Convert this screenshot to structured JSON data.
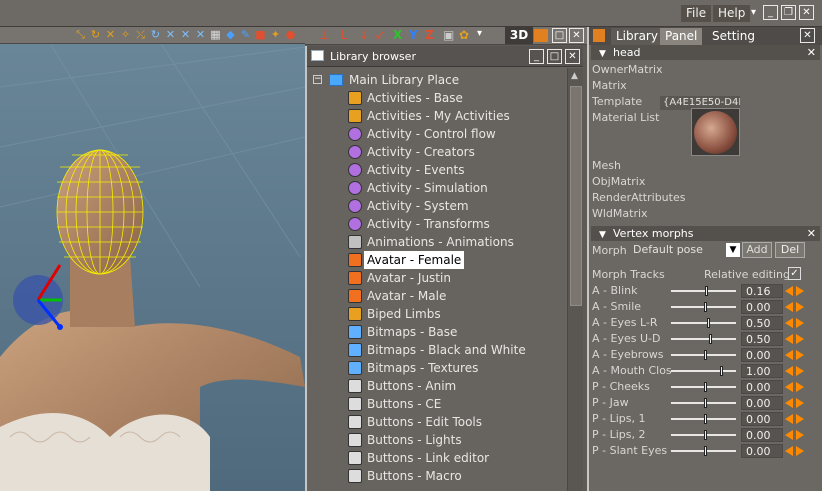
{
  "menubar": {
    "file": "File",
    "help": "Help"
  },
  "viewport": {
    "mode_label": "3D"
  },
  "library": {
    "title": "Library browser",
    "root": "Main Library Place",
    "items": [
      {
        "label": "Activities - Base",
        "icon": "activity-box-icon"
      },
      {
        "label": "Activities - My Activities",
        "icon": "activity-box-icon"
      },
      {
        "label": "Activity - Control flow",
        "icon": "activity-icon"
      },
      {
        "label": "Activity - Creators",
        "icon": "activity-icon"
      },
      {
        "label": "Activity - Events",
        "icon": "activity-icon"
      },
      {
        "label": "Activity - Simulation",
        "icon": "activity-icon"
      },
      {
        "label": "Activity - System",
        "icon": "activity-icon"
      },
      {
        "label": "Activity - Transforms",
        "icon": "activity-icon"
      },
      {
        "label": "Animations - Animations",
        "icon": "animation-icon"
      },
      {
        "label": "Avatar - Female",
        "icon": "avatar-icon",
        "selected": true
      },
      {
        "label": "Avatar - Justin",
        "icon": "avatar-icon"
      },
      {
        "label": "Avatar - Male",
        "icon": "avatar-icon"
      },
      {
        "label": "Biped Limbs",
        "icon": "biped-icon"
      },
      {
        "label": "Bitmaps - Base",
        "icon": "bitmap-icon"
      },
      {
        "label": "Bitmaps - Black and White",
        "icon": "bitmap-icon"
      },
      {
        "label": "Bitmaps - Textures",
        "icon": "bitmap-icon"
      },
      {
        "label": "Buttons - Anim",
        "icon": "button-icon"
      },
      {
        "label": "Buttons - CE",
        "icon": "button-icon"
      },
      {
        "label": "Buttons - Edit Tools",
        "icon": "button-icon"
      },
      {
        "label": "Buttons - Lights",
        "icon": "button-icon"
      },
      {
        "label": "Buttons - Link editor",
        "icon": "button-icon"
      },
      {
        "label": "Buttons - Macro",
        "icon": "button-icon"
      }
    ]
  },
  "panel": {
    "tabs": [
      "Library",
      "Panel",
      "Setting"
    ],
    "head_section": "head",
    "properties": [
      "OwnerMatrix",
      "Matrix",
      "Template",
      "Material List",
      "Mesh",
      "ObjMatrix",
      "RenderAttributes",
      "WldMatrix"
    ],
    "template_value": "{A4E15E50-D4FI",
    "morph_section": "Vertex morphs",
    "morph_label": "Morph",
    "morph_value": "Default pose",
    "add_label": "Add",
    "del_label": "Del",
    "tracks_label": "Morph Tracks",
    "relative_label": "Relative editing",
    "relative_checked": true,
    "tracks": [
      {
        "name": "A - Blink",
        "value": "0.16",
        "level": 0.52
      },
      {
        "name": "A - Smile",
        "value": "0.00",
        "level": 0.5
      },
      {
        "name": "A - Eyes L-R",
        "value": "0.50",
        "level": 0.55
      },
      {
        "name": "A - Eyes U-D",
        "value": "0.50",
        "level": 0.58
      },
      {
        "name": "A - Eyebrows",
        "value": "0.00",
        "level": 0.5
      },
      {
        "name": "A - Mouth Clos",
        "value": "1.00",
        "level": 0.75
      },
      {
        "name": "P - Cheeks",
        "value": "0.00",
        "level": 0.5
      },
      {
        "name": "P - Jaw",
        "value": "0.00",
        "level": 0.5
      },
      {
        "name": "P - Lips, 1",
        "value": "0.00",
        "level": 0.5
      },
      {
        "name": "P - Lips, 2",
        "value": "0.00",
        "level": 0.5
      },
      {
        "name": "P - Slant Eyes",
        "value": "0.00",
        "level": 0.5
      }
    ]
  },
  "colors": {
    "accent": "#ff8a00",
    "selection": "#ffffff",
    "mesh": "#f5f000"
  }
}
